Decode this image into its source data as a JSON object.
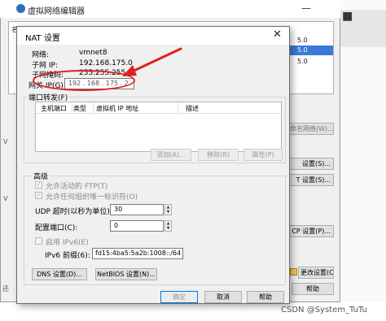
{
  "background_window": {
    "title": "虚拟网络编辑器",
    "table_col_name": "名",
    "table_rows": [
      {
        "value": "5.0"
      },
      {
        "value": "5.0"
      },
      {
        "value": "5.0"
      }
    ],
    "side_items": [
      "V",
      "V"
    ],
    "buttons": {
      "rename_network": "命名网络(W)...",
      "nat_settings_partial": "设置(S)...",
      "nat_settings": "T 设置(S)...",
      "dhcp_settings": "CP 设置(P)...",
      "change_settings": "更改设置(C)",
      "help": "帮助"
    },
    "left_edge_label": "还"
  },
  "dialog": {
    "title": "NAT 设置",
    "info": {
      "network_label": "网络:",
      "network_value": "vmnet8",
      "subnet_ip_label": "子网 IP:",
      "subnet_ip_value": "192.168.175.0",
      "subnet_mask_label": "子网掩码:",
      "subnet_mask_value": "255.255.255.0",
      "gateway_label": "网关 IP(G):",
      "gateway_value": "192 . 168 . 175 . 2"
    },
    "port_forwarding": {
      "group_label": "端口转发(F)",
      "columns": [
        "主机端口",
        "类型",
        "虚拟机 IP 地址",
        "描述"
      ],
      "add_button": "添加(A)...",
      "remove_button": "移除(R)",
      "properties_button": "属性(P)"
    },
    "advanced": {
      "group_label": "高级",
      "allow_ftp": "允许活动的 FTP(T)",
      "allow_org_id": "允许任何组织唯一标识符(O)",
      "udp_timeout_label": "UDP 超时(以秒为单位)(U):",
      "udp_timeout_value": "30",
      "config_port_label": "配置端口(C):",
      "config_port_value": "0",
      "enable_ipv6": "启用 IPv6(E)",
      "ipv6_prefix_label": "IPv6 前缀(6):",
      "ipv6_prefix_value": "fd15:4ba5:5a2b:1008::/64",
      "dns_button": "DNS 设置(D)...",
      "netbios_button": "NetBIOS 设置(N)..."
    },
    "footer": {
      "ok": "确定",
      "cancel": "取消",
      "help": "帮助"
    }
  },
  "annotation": {
    "color": "#e02020"
  },
  "watermark": "CSDN @System_TuTu"
}
